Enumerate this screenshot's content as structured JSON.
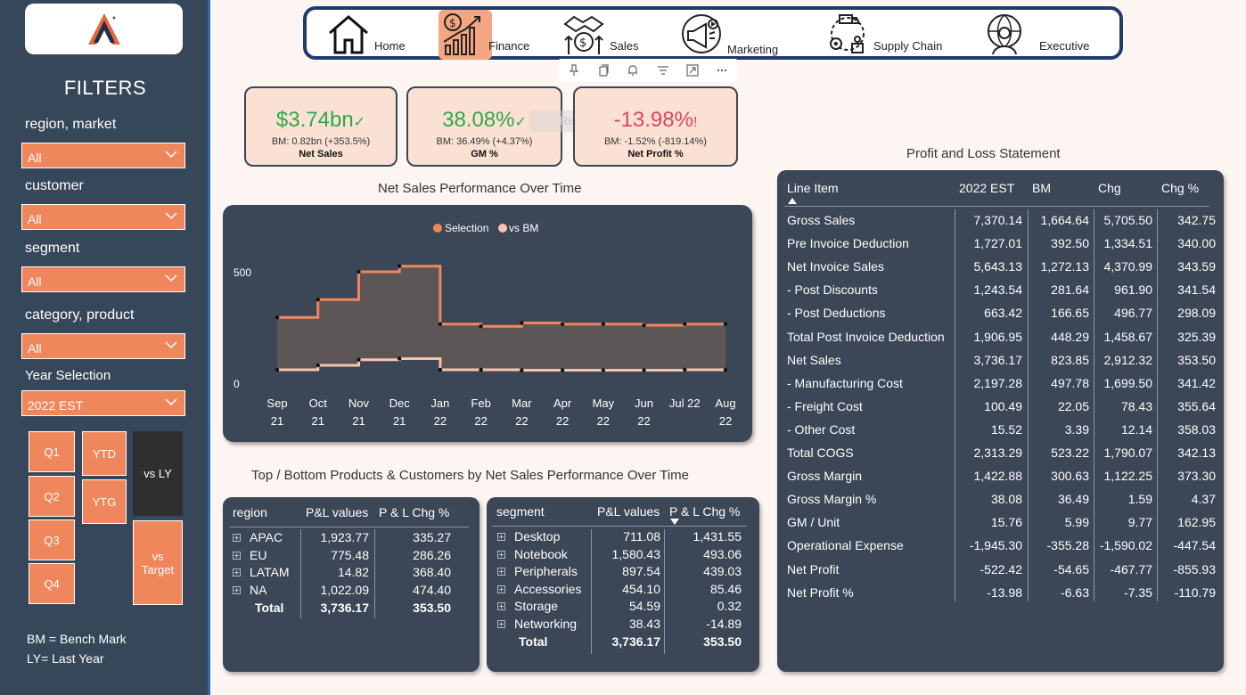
{
  "sidebar": {
    "filters_title": "FILTERS",
    "filters": [
      {
        "label": "region, market",
        "value": "All"
      },
      {
        "label": "customer",
        "value": "All"
      },
      {
        "label": "segment",
        "value": "All"
      },
      {
        "label": "category, product",
        "value": "All"
      },
      {
        "label": "Year Selection",
        "value": "2022 EST"
      }
    ],
    "tiles": {
      "q1": "Q1",
      "q2": "Q2",
      "q3": "Q3",
      "q4": "Q4",
      "ytd": "YTD",
      "ytg": "YTG",
      "vs_ly": "vs LY",
      "vs_target": "vs Target"
    },
    "notes": [
      "BM = Bench Mark",
      "LY= Last Year"
    ]
  },
  "nav": {
    "items": [
      {
        "label": "Home",
        "icon": "home-icon"
      },
      {
        "label": "Finance",
        "icon": "finance-growth-icon",
        "active": true
      },
      {
        "label": "Sales",
        "icon": "sales-handshake-icon"
      },
      {
        "label": "Marketing",
        "icon": "marketing-megaphone-icon"
      },
      {
        "label": "Supply Chain",
        "icon": "supply-chain-truck-icon"
      },
      {
        "label": "Executive",
        "icon": "executive-globe-icon"
      }
    ],
    "active_color": "#f4a582"
  },
  "kpis": [
    {
      "value": "$3.74bn",
      "mark": "✓",
      "sub": "BM: 0.82bn (+353.5%)",
      "name": "Net Sales",
      "color": "#2ea84a"
    },
    {
      "value": "38.08%",
      "mark": "✓",
      "sub": "BM: 36.49% (+4.37%)",
      "name": "GM %",
      "color": "#2ea84a"
    },
    {
      "value": "-13.98%",
      "mark": "!",
      "sub": "BM: -1.52% (-819.14%)",
      "name": "Net Profit %",
      "color": "#d9475f"
    }
  ],
  "ghost_label": "Rectangle",
  "titles": {
    "net_sales_chart": "Net Sales Performance Over Time",
    "top_bottom": "Top / Bottom Products & Customers by Net Sales Performance Over Time",
    "pl": "Profit and Loss Statement"
  },
  "chart_data": {
    "type": "area",
    "title": "Net Sales Performance Over Time",
    "categories": [
      "Sep 21",
      "Oct 21",
      "Nov 21",
      "Dec 21",
      "Jan 22",
      "Feb 22",
      "Mar 22",
      "Apr 22",
      "May 22",
      "Jun 22",
      "Jul 22",
      "Aug 22"
    ],
    "x_top": [
      "Sep",
      "Oct",
      "Nov",
      "Dec",
      "Jan",
      "Feb",
      "Mar",
      "Apr",
      "May",
      "Jun",
      "Jul 22",
      "Aug"
    ],
    "x_bottom": [
      "21",
      "21",
      "21",
      "21",
      "22",
      "22",
      "22",
      "22",
      "22",
      "22",
      "",
      "22"
    ],
    "yticks": [
      0,
      500
    ],
    "ylim": [
      0,
      560
    ],
    "series": [
      {
        "name": "Selection",
        "color": "#f0875c",
        "values": [
          295,
          375,
          500,
          525,
          265,
          255,
          270,
          265,
          265,
          260,
          265,
          265
        ]
      },
      {
        "name": "vs BM",
        "color": "#f7c4ad",
        "values": [
          60,
          80,
          105,
          110,
          60,
          60,
          58,
          58,
          58,
          58,
          60,
          60
        ]
      }
    ],
    "legend": "top-center",
    "step": true
  },
  "region_table": {
    "headers": [
      "region",
      "P&L values",
      "P & L Chg %"
    ],
    "rows": [
      [
        "APAC",
        "1,923.77",
        "335.27"
      ],
      [
        "EU",
        "775.48",
        "286.26"
      ],
      [
        "LATAM",
        "14.82",
        "368.40"
      ],
      [
        "NA",
        "1,022.09",
        "474.40"
      ]
    ],
    "total": [
      "Total",
      "3,736.17",
      "353.50"
    ]
  },
  "segment_table": {
    "headers": [
      "segment",
      "P&L values",
      "P & L Chg %"
    ],
    "rows": [
      [
        "Desktop",
        "711.08",
        "1,431.55"
      ],
      [
        "Notebook",
        "1,580.43",
        "493.06"
      ],
      [
        "Peripherals",
        "897.54",
        "439.03"
      ],
      [
        "Accessories",
        "454.10",
        "85.46"
      ],
      [
        "Storage",
        "54.59",
        "0.32"
      ],
      [
        "Networking",
        "38.43",
        "-14.89"
      ]
    ],
    "total": [
      "Total",
      "3,736.17",
      "353.50"
    ]
  },
  "pl_table": {
    "headers": [
      "Line Item",
      "2022 EST",
      "BM",
      "Chg",
      "Chg %"
    ],
    "rows": [
      [
        "Gross Sales",
        "7,370.14",
        "1,664.64",
        "5,705.50",
        "342.75"
      ],
      [
        "Pre Invoice Deduction",
        "1,727.01",
        "392.50",
        "1,334.51",
        "340.00"
      ],
      [
        "Net Invoice Sales",
        "5,643.13",
        "1,272.13",
        "4,370.99",
        "343.59"
      ],
      [
        "- Post Discounts",
        "1,243.54",
        "281.64",
        "961.90",
        "341.54"
      ],
      [
        "- Post Deductions",
        "663.42",
        "166.65",
        "496.77",
        "298.09"
      ],
      [
        "Total Post Invoice Deduction",
        "1,906.95",
        "448.29",
        "1,458.67",
        "325.39"
      ],
      [
        "Net Sales",
        "3,736.17",
        "823.85",
        "2,912.32",
        "353.50"
      ],
      [
        "- Manufacturing Cost",
        "2,197.28",
        "497.78",
        "1,699.50",
        "341.42"
      ],
      [
        "- Freight Cost",
        "100.49",
        "22.05",
        "78.43",
        "355.64"
      ],
      [
        "- Other Cost",
        "15.52",
        "3.39",
        "12.14",
        "358.03"
      ],
      [
        "Total COGS",
        "2,313.29",
        "523.22",
        "1,790.07",
        "342.13"
      ],
      [
        "Gross Margin",
        "1,422.88",
        "300.63",
        "1,122.25",
        "373.30"
      ],
      [
        "Gross Margin %",
        "38.08",
        "36.49",
        "1.59",
        "4.37"
      ],
      [
        "GM / Unit",
        "15.76",
        "5.99",
        "9.77",
        "162.95"
      ],
      [
        "Operational Expense",
        "-1,945.30",
        "-355.28",
        "-1,590.02",
        "-447.54"
      ],
      [
        "Net Profit",
        "-522.42",
        "-54.65",
        "-467.77",
        "-855.93"
      ],
      [
        "Net Profit %",
        "-13.98",
        "-6.63",
        "-7.35",
        "-110.79"
      ]
    ]
  }
}
